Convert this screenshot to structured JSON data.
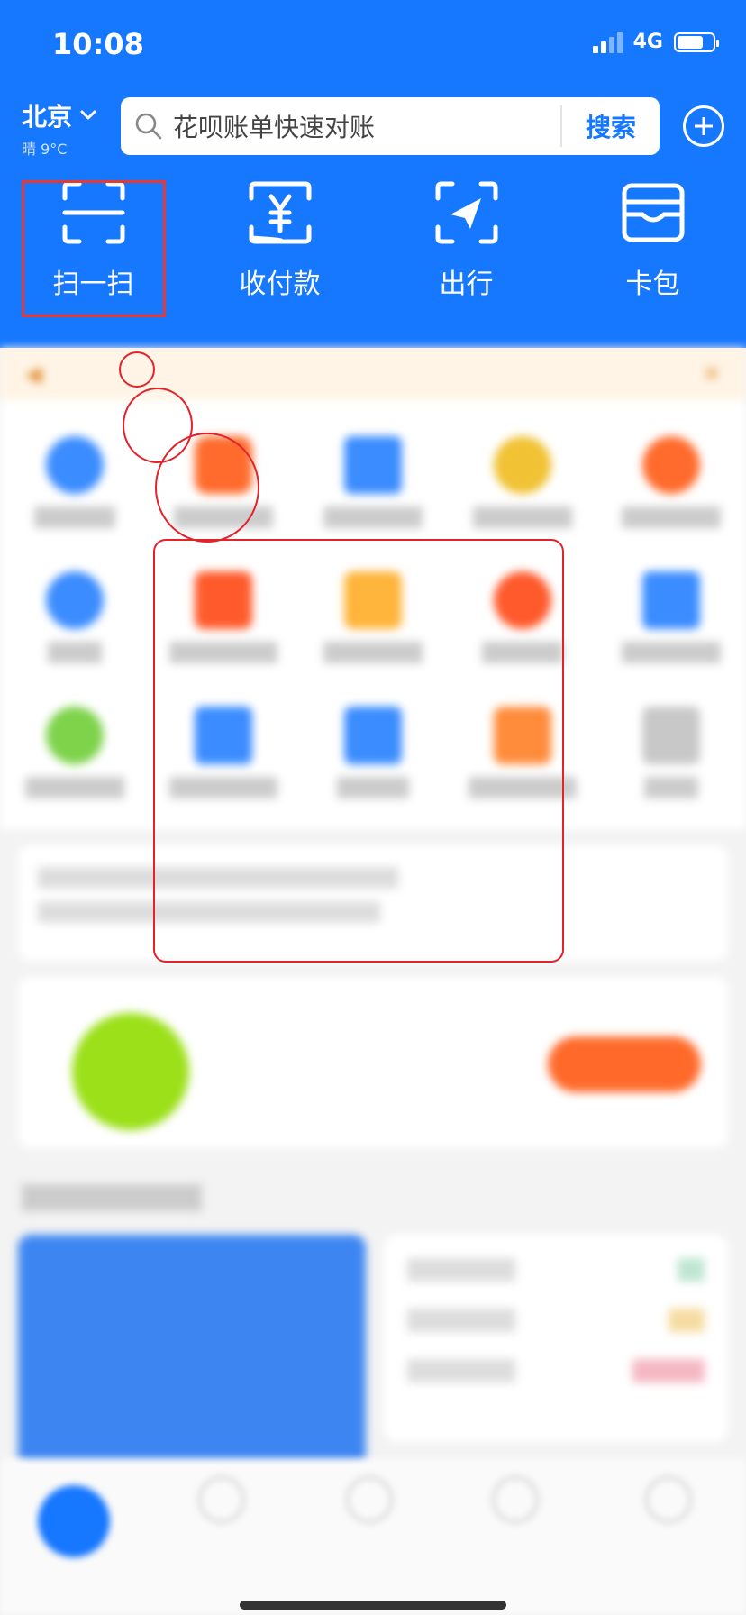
{
  "status_bar": {
    "time": "10:08",
    "network": "4G",
    "signal_level": 0.5,
    "battery_level": 0.7
  },
  "header": {
    "city": "北京",
    "weather": "晴 9°C",
    "search_placeholder": "花呗账单快速对账",
    "search_button": "搜索"
  },
  "quick_actions": [
    {
      "label": "扫一扫",
      "icon": "scan-icon"
    },
    {
      "label": "收付款",
      "icon": "payment-code-icon"
    },
    {
      "label": "出行",
      "icon": "travel-arrow-icon"
    },
    {
      "label": "卡包",
      "icon": "wallet-card-icon"
    }
  ],
  "colors": {
    "brand_blue": "#1677ff",
    "highlight_red": "#e53935"
  }
}
